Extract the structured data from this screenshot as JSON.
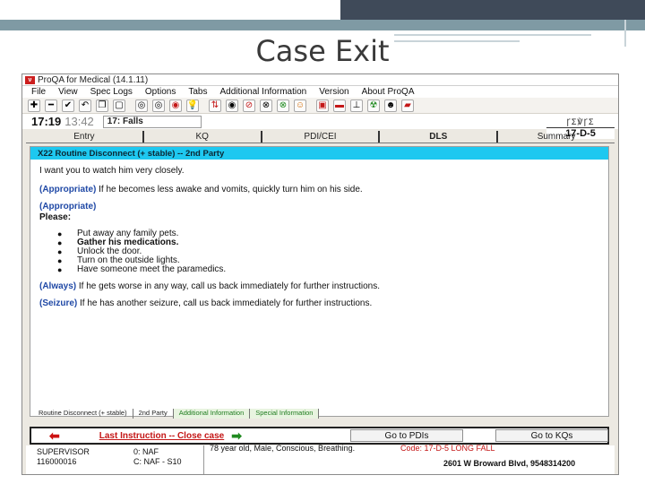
{
  "slide": {
    "title": "Case Exit"
  },
  "window": {
    "title": "ProQA for Medical (14.1.11)",
    "logo_text": "ν"
  },
  "menu": [
    "File",
    "View",
    "Spec Logs",
    "Options",
    "Tabs",
    "Additional Information",
    "Version",
    "About ProQA"
  ],
  "toolbar_icons": [
    "plus-icon",
    "minus-icon",
    "check-icon",
    "undo-icon",
    "copy-icon",
    "new-doc-icon",
    "circle-icon",
    "circle-icon",
    "stop-icon",
    "bulb-icon",
    "green-arrows-icon",
    "eye-icon",
    "no-entry-icon",
    "x-circle-icon",
    "green-x-icon",
    "face-icon",
    "pdf-icon",
    "dispatch-icon",
    "tools-icon",
    "hazard-icon",
    "face-icon",
    "car-icon"
  ],
  "info": {
    "time_main": "17:19",
    "time_secondary": "13:42",
    "chief_complaint": "17: Falls",
    "determinant_code": "17-D-5",
    "code_logo": "ꞄΣ℣ꞄΣ"
  },
  "tabs": [
    {
      "label": "Entry",
      "active": false
    },
    {
      "label": "KQ",
      "active": false
    },
    {
      "label": "PDI/CEI",
      "active": false
    },
    {
      "label": "DLS",
      "active": true
    },
    {
      "label": "Summary",
      "active": false
    }
  ],
  "panel": {
    "header": "X22 Routine Disconnect (+ stable) -- 2nd Party",
    "line1": "I want you to watch him very closely.",
    "line2_tag": "(Appropriate)",
    "line2_text": "If he becomes less awake and vomits, quickly turn him on his side.",
    "line3_tag": "(Appropriate)",
    "line3_please": "Please:",
    "bullets": [
      "Put away any family pets.",
      "Gather his medications.",
      "Unlock the door.",
      "Turn on the outside lights.",
      "Have someone meet the paramedics."
    ],
    "line4_tag": "(Always)",
    "line4_text": "If he gets worse in any way, call us back immediately for further instructions.",
    "line5_tag": "(Seizure)",
    "line5_text": "If he has another seizure, call us back immediately for further instructions."
  },
  "lower_tabs": [
    {
      "label": "Routine Disconnect (+ stable)",
      "style": "normal"
    },
    {
      "label": "2nd Party",
      "style": "normal"
    },
    {
      "label": "Additional Information",
      "style": "green"
    },
    {
      "label": "Special Information",
      "style": "green"
    }
  ],
  "actions": {
    "last_instruction": "Last Instruction -- Close case",
    "go_pdis": "Go to PDIs",
    "go_kqs": "Go to KQs"
  },
  "status": {
    "user": "SUPERVISOR",
    "case_number": "116000016",
    "a_label": "0: NAF",
    "c_label": "C: NAF - S10",
    "summary": "78 year old, Male, Conscious, Breathing.",
    "code_line": "Code: 17-D-5 LONG FALL",
    "address": "2601 W Broward Blvd, 9548314200"
  }
}
